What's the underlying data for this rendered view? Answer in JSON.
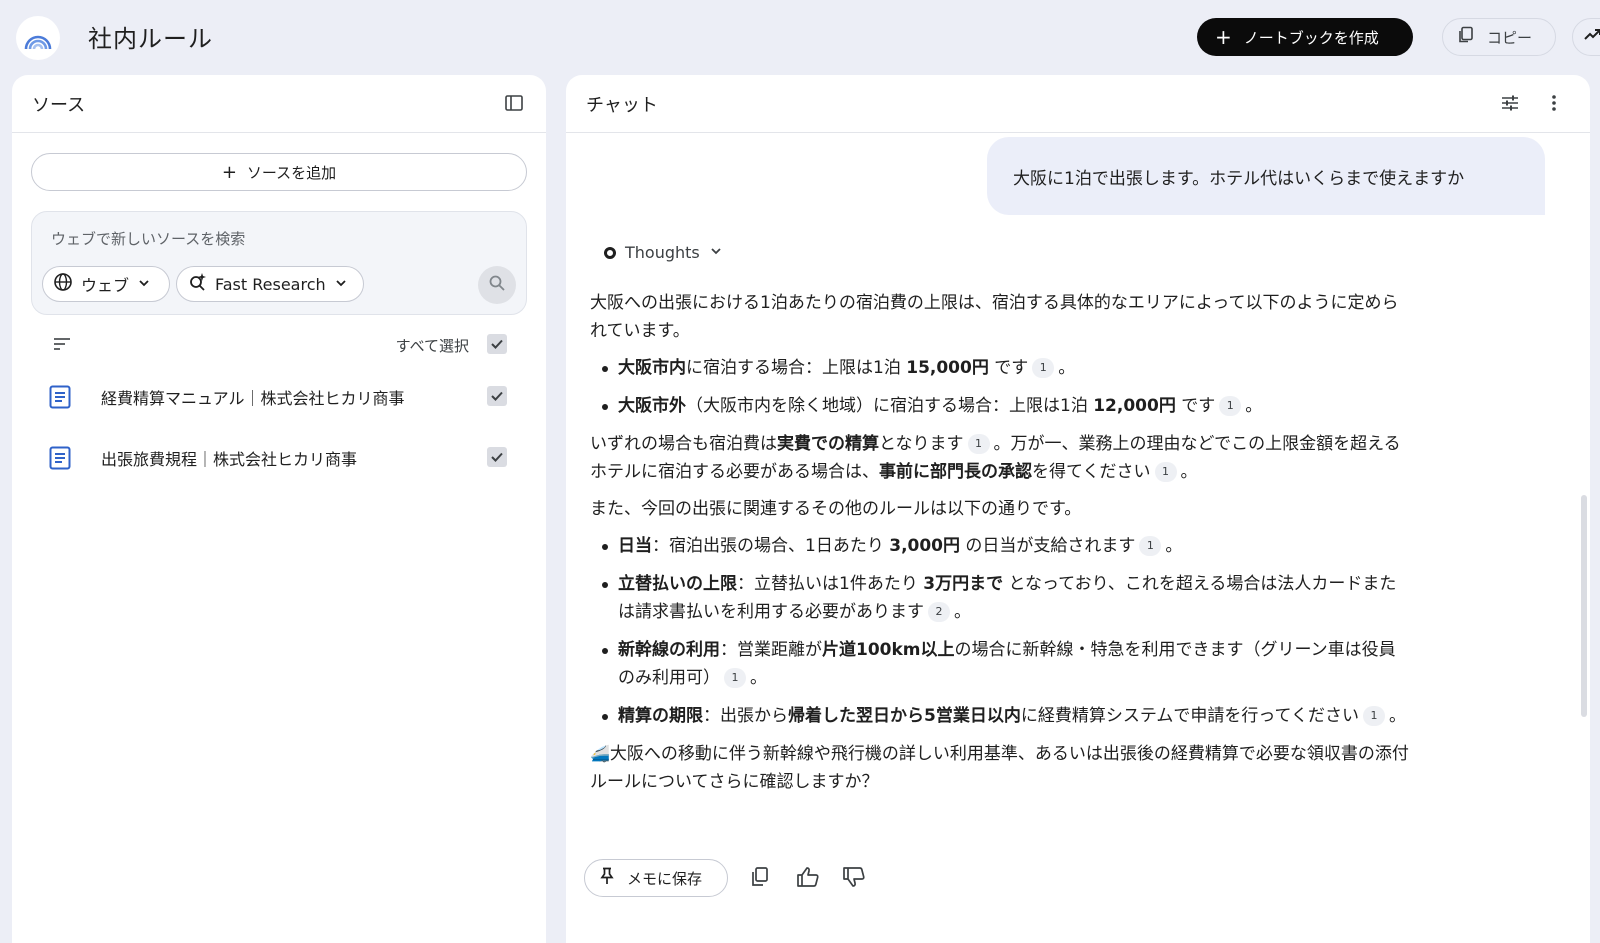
{
  "header": {
    "title": "社内ルール",
    "create_notebook": "ノートブックを作成",
    "copy": "コピー",
    "icons": {
      "logo": "rainbow-logo",
      "plus": "plus-icon",
      "copy": "copy-icon",
      "analytics": "trending-icon"
    }
  },
  "sources_panel": {
    "title": "ソース",
    "add_source": "ソースを追加",
    "search_placeholder": "ウェブで新しいソースを検索",
    "web_chip": "ウェブ",
    "research_chip": "Fast Research",
    "select_all": "すべて選択",
    "items": [
      {
        "label": "経費精算マニュアル｜株式会社ヒカリ商事",
        "checked": true
      },
      {
        "label": "出張旅費規程｜株式会社ヒカリ商事",
        "checked": true
      }
    ]
  },
  "chat_panel": {
    "title": "チャット",
    "user_message": "大阪に1泊で出張します。ホテル代はいくらまで使えますか",
    "thoughts": "Thoughts",
    "answer": {
      "intro": "大阪への出張における1泊あたりの宿泊費の上限は、宿泊する具体的なエリアによって以下のように定められています。",
      "b1_bold": "大阪市内",
      "b1_mid": "に宿泊する場合：上限は1泊 ",
      "b1_amount": "15,000円",
      "b1_end": " です",
      "b2_bold": "大阪市外",
      "b2_mid": "（大阪市内を除く地域）に宿泊する場合：上限は1泊 ",
      "b2_amount": "12,000円",
      "b2_end": " です",
      "p2_a": "いずれの場合も宿泊費は",
      "p2_bold1": "実費での精算",
      "p2_b": "となります",
      "p2_c": "。万が一、業務上の理由などでこの上限金額を超えるホテルに宿泊する必要がある場合は、",
      "p2_bold2": "事前に部門長の承認",
      "p2_d": "を得てください",
      "p3": "また、今回の出張に関連するその他のルールは以下の通りです。",
      "r1_bold": "日当",
      "r1_a": "：宿泊出張の場合、1日あたり ",
      "r1_amount": "3,000円",
      "r1_b": " の日当が支給されます",
      "r2_bold": "立替払いの上限",
      "r2_a": "：立替払いは1件あたり ",
      "r2_amount": "3万円まで",
      "r2_b": " となっており、これを超える場合は法人カードまたは請求書払いを利用する必要があります",
      "r3_bold": "新幹線の利用",
      "r3_a": "：営業距離が",
      "r3_bold2": "片道100km以上",
      "r3_b": "の場合に新幹線・特急を利用できます（グリーン車は役員のみ利用可）",
      "r4_bold": "精算の期限",
      "r4_a": "：出張から",
      "r4_bold2": "帰着した翌日から5営業日以内",
      "r4_b": "に経費精算システムで申請を行ってください",
      "closing": "大阪への移動に伴う新幹線や飛行機の詳しい利用基準、あるいは出張後の経費精算で必要な領収書の添付ルールについてさらに確認しますか？",
      "period": "。",
      "cite1": "1",
      "cite2": "2",
      "train_emoji": "🚄"
    },
    "save_memo": "メモに保存"
  }
}
